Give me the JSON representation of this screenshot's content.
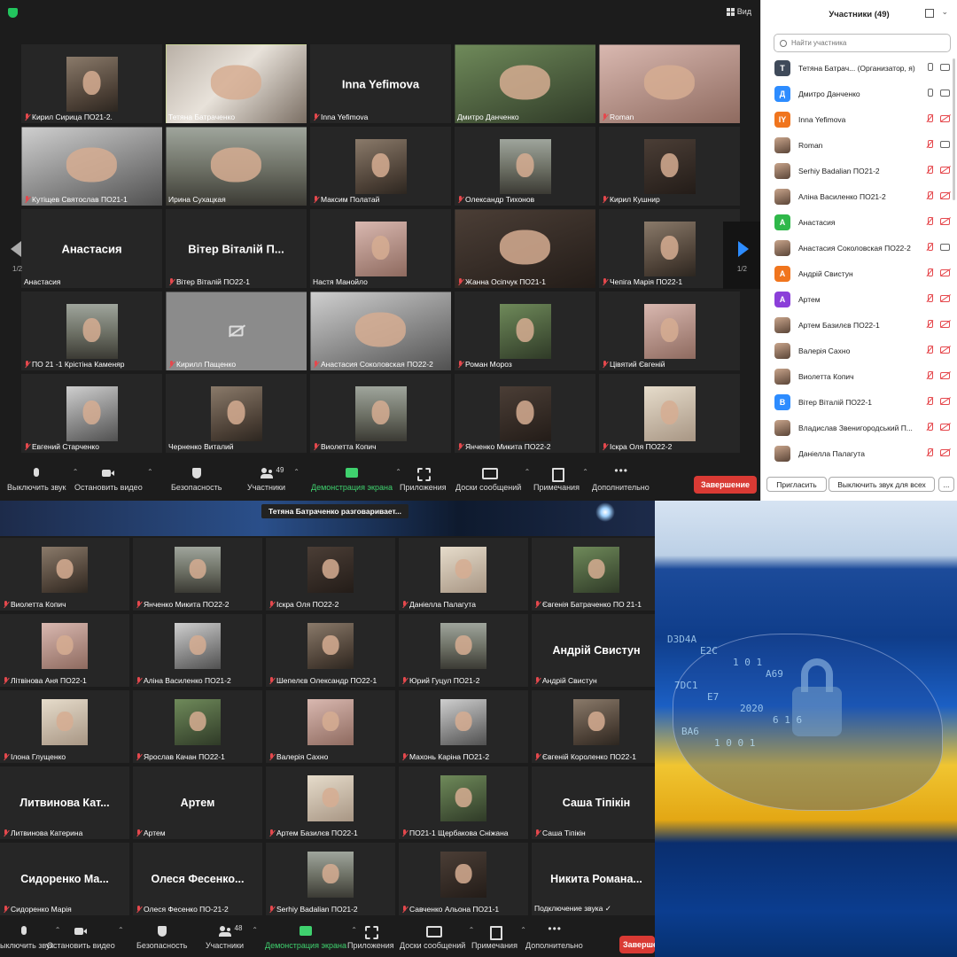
{
  "top_window": {
    "view_label": "Вид",
    "page_indicator": "1/2",
    "tiles": [
      {
        "name": "Кирил Сирица ПО21-2.",
        "video": "photo",
        "muted": true
      },
      {
        "name": "Тетяна Батраченко",
        "video": "wide",
        "muted": false,
        "active": true
      },
      {
        "name": "Inna Yefimova",
        "video": "name",
        "big_name": "Inna Yefimova",
        "muted": true
      },
      {
        "name": "Дмитро Данченко",
        "video": "wide",
        "muted": false
      },
      {
        "name": "Roman",
        "video": "wide",
        "muted": true
      },
      {
        "name": "Кутіщев Святослав ПО21-1",
        "video": "wide",
        "muted": true
      },
      {
        "name": "Ирина Сухацкая",
        "video": "wide",
        "muted": false
      },
      {
        "name": "Максим Полатай",
        "video": "photo",
        "muted": true
      },
      {
        "name": "Олександр Тихонов",
        "video": "photo",
        "muted": true
      },
      {
        "name": "Кирил Кушнир",
        "video": "photo",
        "muted": true
      },
      {
        "name": "Анастасия",
        "video": "name",
        "big_name": "Анастасия",
        "muted": false
      },
      {
        "name": "Вітер Віталій ПО22-1",
        "video": "name",
        "big_name": "Вітер Віталій П...",
        "muted": true
      },
      {
        "name": "Настя Манойло",
        "video": "photo",
        "muted": false
      },
      {
        "name": "Жанна Осіпчук ПО21-1",
        "video": "wide",
        "muted": true
      },
      {
        "name": "Чепіга Марія ПО22-1",
        "video": "photo",
        "muted": true
      },
      {
        "name": "ПО 21 -1 Крістіна Каменяр",
        "video": "photo",
        "muted": true
      },
      {
        "name": "Кирилл Пащенко",
        "video": "off",
        "muted": true
      },
      {
        "name": "Анастасия Соколовская ПО22-2",
        "video": "wide",
        "muted": true
      },
      {
        "name": "Роман Мороз",
        "video": "photo",
        "muted": true
      },
      {
        "name": "Цівятий Євгеній",
        "video": "photo",
        "muted": true
      },
      {
        "name": "Евгений Старченко",
        "video": "photo",
        "muted": true
      },
      {
        "name": "Черненко Виталий",
        "video": "photo",
        "muted": false
      },
      {
        "name": "Виолетта Копич",
        "video": "photo",
        "muted": true
      },
      {
        "name": "Янченко Микита ПО22-2",
        "video": "photo",
        "muted": true
      },
      {
        "name": "Іскра Оля ПО22-2",
        "video": "photo",
        "muted": true
      }
    ],
    "toolbar": {
      "mute": "Выключить звук",
      "video": "Остановить видео",
      "security": "Безопасность",
      "participants": "Участники",
      "participants_count": "49",
      "share": "Демонстрация экрана",
      "apps": "Приложения",
      "boards": "Доски сообщений",
      "notes": "Примечания",
      "more": "Дополнительно",
      "end": "Завершение"
    }
  },
  "participants_panel": {
    "title": "Участники (49)",
    "search_placeholder": "Найти участника",
    "invite": "Пригласить",
    "mute_all": "Выключить звук для всех",
    "more": "...",
    "people": [
      {
        "initial": "T",
        "color": "#3f4a5a",
        "name": "Тетяна Батрач...  (Организатор, я)",
        "mic": "on",
        "cam": "on"
      },
      {
        "initial": "Д",
        "color": "#2d8cff",
        "name": "Дмитро Данченко",
        "mic": "on",
        "cam": "on"
      },
      {
        "initial": "IY",
        "color": "#f0751e",
        "name": "Inna Yefimova",
        "mic": "off",
        "cam": "off"
      },
      {
        "initial": "",
        "color": "photo",
        "name": "Roman",
        "mic": "off",
        "cam": "on"
      },
      {
        "initial": "",
        "color": "photo",
        "name": "Serhiy Badalian ПО21-2",
        "mic": "off",
        "cam": "off"
      },
      {
        "initial": "",
        "color": "photo",
        "name": "Аліна Василенко ПО21-2",
        "mic": "off",
        "cam": "off"
      },
      {
        "initial": "A",
        "color": "#2fb84a",
        "name": "Анастасия",
        "mic": "off",
        "cam": "off"
      },
      {
        "initial": "",
        "color": "photo",
        "name": "Анастасия Соколовская ПО22-2",
        "mic": "off",
        "cam": "on"
      },
      {
        "initial": "A",
        "color": "#f0751e",
        "name": "Андрій Свистун",
        "mic": "off",
        "cam": "off"
      },
      {
        "initial": "A",
        "color": "#8b3fd9",
        "name": "Артем",
        "mic": "off",
        "cam": "off"
      },
      {
        "initial": "",
        "color": "photo",
        "name": "Артем Базилєв ПО22-1",
        "mic": "off",
        "cam": "off"
      },
      {
        "initial": "",
        "color": "photo",
        "name": "Валерія Сахно",
        "mic": "off",
        "cam": "off"
      },
      {
        "initial": "",
        "color": "photo",
        "name": "Виолетта Копич",
        "mic": "off",
        "cam": "off"
      },
      {
        "initial": "B",
        "color": "#2d8cff",
        "name": "Вітер Віталій ПО22-1",
        "mic": "off",
        "cam": "off"
      },
      {
        "initial": "",
        "color": "photo",
        "name": "Владислав Звенигородський П...",
        "mic": "off",
        "cam": "off"
      },
      {
        "initial": "",
        "color": "photo",
        "name": "Даніелла Палагута",
        "mic": "off",
        "cam": "off"
      }
    ]
  },
  "bottom_window": {
    "talking": "Тетяна Батраченко разговаривает...",
    "tiles": [
      {
        "name": "Виолетта Копич",
        "video": "photo",
        "muted": true
      },
      {
        "name": "Янченко Микита ПО22-2",
        "video": "photo",
        "muted": true
      },
      {
        "name": "Іскра Оля ПО22-2",
        "video": "photo",
        "muted": true
      },
      {
        "name": "Даніелла Палагута",
        "video": "photo",
        "muted": true
      },
      {
        "name": "Євгенія Батраченко ПО 21-1",
        "video": "photo",
        "muted": true
      },
      {
        "name": "Літвінова Аня ПО22-1",
        "video": "photo",
        "muted": true
      },
      {
        "name": "Аліна Василенко ПО21-2",
        "video": "photo",
        "muted": true
      },
      {
        "name": "Шепелєв Олександр  ПО22-1",
        "video": "photo",
        "muted": true
      },
      {
        "name": "Юрий Гуцул ПО21-2",
        "video": "photo",
        "muted": true
      },
      {
        "name": "Андрій Свистун",
        "video": "name",
        "big_name": "Андрій Свистун",
        "muted": true
      },
      {
        "name": "Ілона Глущенко",
        "video": "photo",
        "muted": true
      },
      {
        "name": "Ярослав Качан ПО22-1",
        "video": "photo",
        "muted": true
      },
      {
        "name": "Валерія Сахно",
        "video": "photo",
        "muted": true
      },
      {
        "name": "Махонь Каріна ПО21-2",
        "video": "photo",
        "muted": true
      },
      {
        "name": "Євгеній Короленко ПО22-1",
        "video": "photo",
        "muted": true
      },
      {
        "name": "Литвинова Катерина",
        "video": "name",
        "big_name": "Литвинова  Кат...",
        "muted": true
      },
      {
        "name": "Артем",
        "video": "name",
        "big_name": "Артем",
        "muted": true
      },
      {
        "name": "Артем Базилєв ПО22-1",
        "video": "photo",
        "muted": true
      },
      {
        "name": "ПО21-1 Щербакова Сніжана",
        "video": "photo",
        "muted": true
      },
      {
        "name": "Саша Тіпікін",
        "video": "name",
        "big_name": "Саша Тіпікін",
        "muted": true
      },
      {
        "name": "Сидоренко Марія",
        "video": "name",
        "big_name": "Сидоренко  Ма...",
        "muted": true
      },
      {
        "name": "Олеся Фесенко ПО-21-2",
        "video": "name",
        "big_name": "Олеся  Фесенко...",
        "muted": true
      },
      {
        "name": "Serhiy Badalian ПО21-2",
        "video": "photo",
        "muted": true
      },
      {
        "name": "Савченко Альона ПО21-1",
        "video": "photo",
        "muted": true
      },
      {
        "name": "Подключение звука ✓",
        "video": "name",
        "big_name": "Никита  Романа...",
        "muted": false
      }
    ],
    "toolbar": {
      "mute": "Выключить звук",
      "video": "Остановить видео",
      "security": "Безопасность",
      "participants": "Участники",
      "participants_count": "48",
      "share": "Демонстрация экрана",
      "apps": "Приложения",
      "boards": "Доски сообщений",
      "notes": "Примечания",
      "more": "Дополнительно",
      "end": "Завершени"
    }
  },
  "cyber_image": {
    "text_rows": [
      "D3D4A",
      "E2C",
      "1 0 1",
      "A69",
      "7DC1",
      "E7",
      "2020",
      "6 1 6",
      "BA6",
      "1 0 0 1"
    ]
  }
}
